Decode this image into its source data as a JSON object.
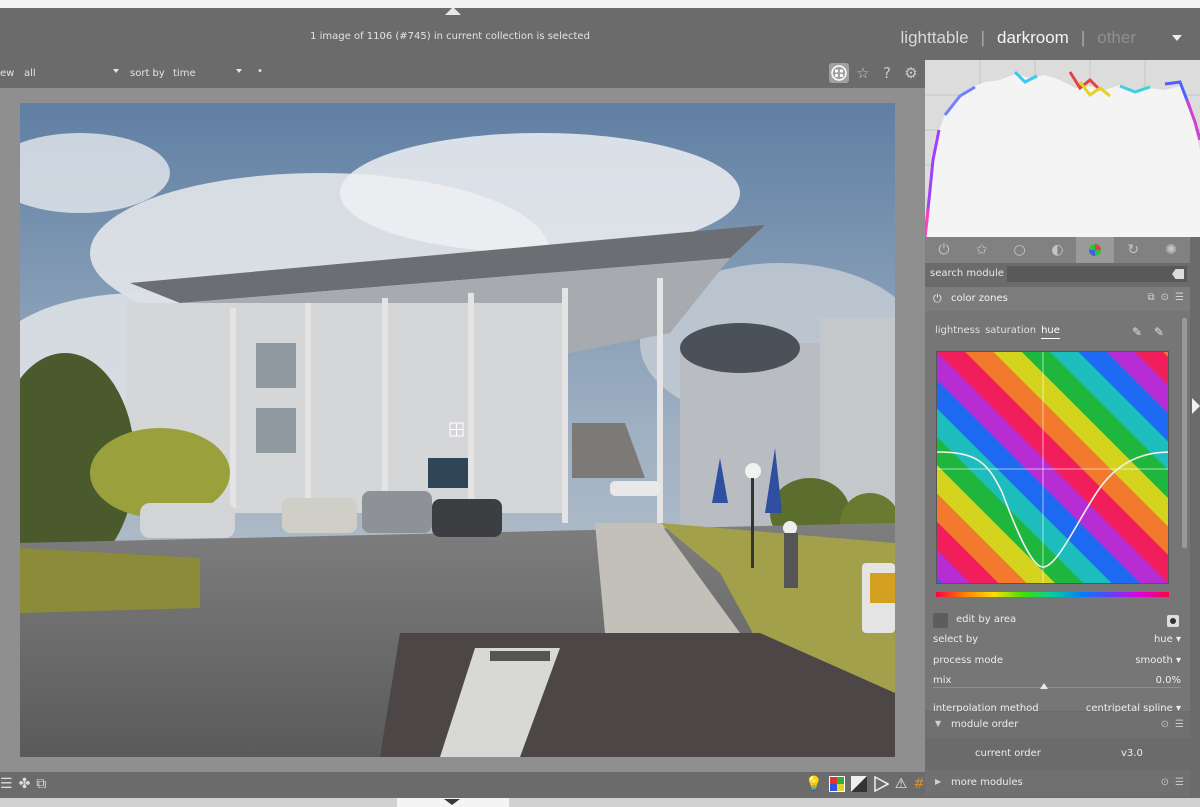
{
  "header": {
    "selection_message": "1 image of 1106 (#745) in current collection is selected",
    "views": [
      "lighttable",
      "darkroom",
      "other"
    ],
    "active_view": "darkroom"
  },
  "filterbar": {
    "view_label": "ew",
    "view_value": "all",
    "sort_label": "sort by",
    "sort_value": "time",
    "extra_dot": "•"
  },
  "right_panel": {
    "search": {
      "label": "search module",
      "value": ""
    },
    "module": {
      "title": "color zones",
      "tabs": [
        "lightness",
        "saturation",
        "hue"
      ],
      "active_tab": "hue",
      "edit_by_area_label": "edit by area",
      "select_by": {
        "label": "select by",
        "value": "hue"
      },
      "process_mode": {
        "label": "process mode",
        "value": "smooth"
      },
      "mix": {
        "label": "mix",
        "value": "0.0%",
        "level": 0.0
      },
      "interpolation": {
        "label": "interpolation method",
        "value": "centripetal spline"
      }
    },
    "module_order": {
      "title": "module order",
      "label": "current order",
      "value": "v3.0"
    },
    "more_modules": {
      "title": "more modules"
    }
  },
  "colors": {
    "panel_bg": "#6b6b6b",
    "center_bg": "#8f8f8f",
    "histogram_bg": "#dcdcdc",
    "text_light": "#e4e4e4"
  },
  "icons": {
    "filterbar": [
      "grouping-icon",
      "star-icon",
      "help-icon",
      "gear-icon"
    ],
    "module_groups": [
      "power-icon",
      "favorites-icon",
      "base-icon",
      "tone-icon",
      "color-icon",
      "correct-icon",
      "effect-icon"
    ],
    "bottom_left": [
      "list-icon",
      "styles-icon",
      "display-icon"
    ],
    "bottom_right": [
      "bulb-icon",
      "color-assessment-icon",
      "softproof-icon",
      "gamut-check-icon",
      "warning-icon",
      "guides-icon"
    ]
  }
}
